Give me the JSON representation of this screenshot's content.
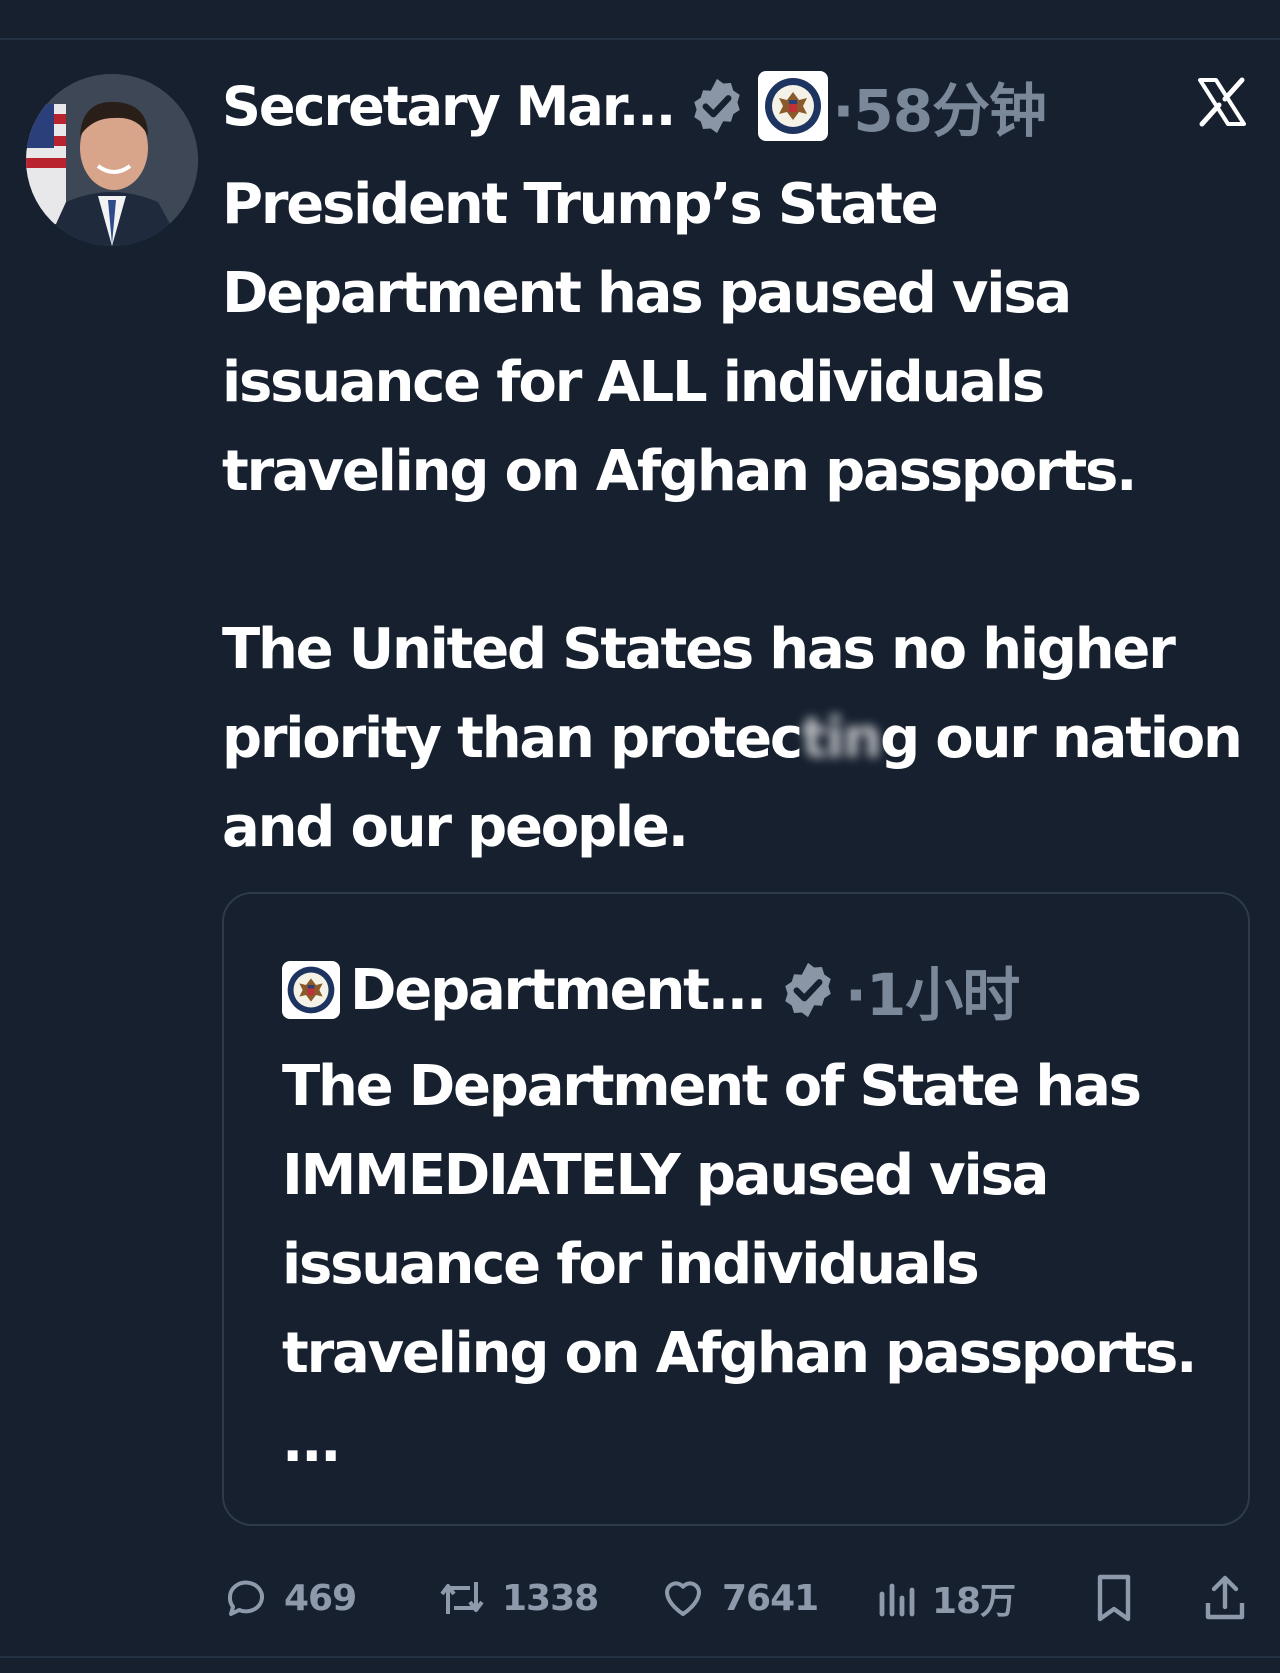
{
  "post": {
    "author_name": "Secretary Mar...",
    "dot_time": "·58分钟",
    "paragraphs": [
      {
        "before": "President Trump’s State Department has paused visa issuance for ALL individuals traveling on Afghan passports.",
        "blurred": "",
        "after": ""
      },
      {
        "before": "The United States has no higher priority than protec",
        "blurred": "tin",
        "after": "g our nation and our people."
      }
    ]
  },
  "quoted": {
    "author_name": "Department...",
    "dot_time": "·1小时",
    "text": "The Department of State has IMMEDIATELY paused visa issuance for individuals traveling on Afghan passports. ..."
  },
  "actions": {
    "replies": "469",
    "reposts": "1338",
    "likes": "7641",
    "views": "18万"
  },
  "colors": {
    "background": "#16202e",
    "muted": "#7a8899",
    "verified_badge": "#8a96a6"
  }
}
